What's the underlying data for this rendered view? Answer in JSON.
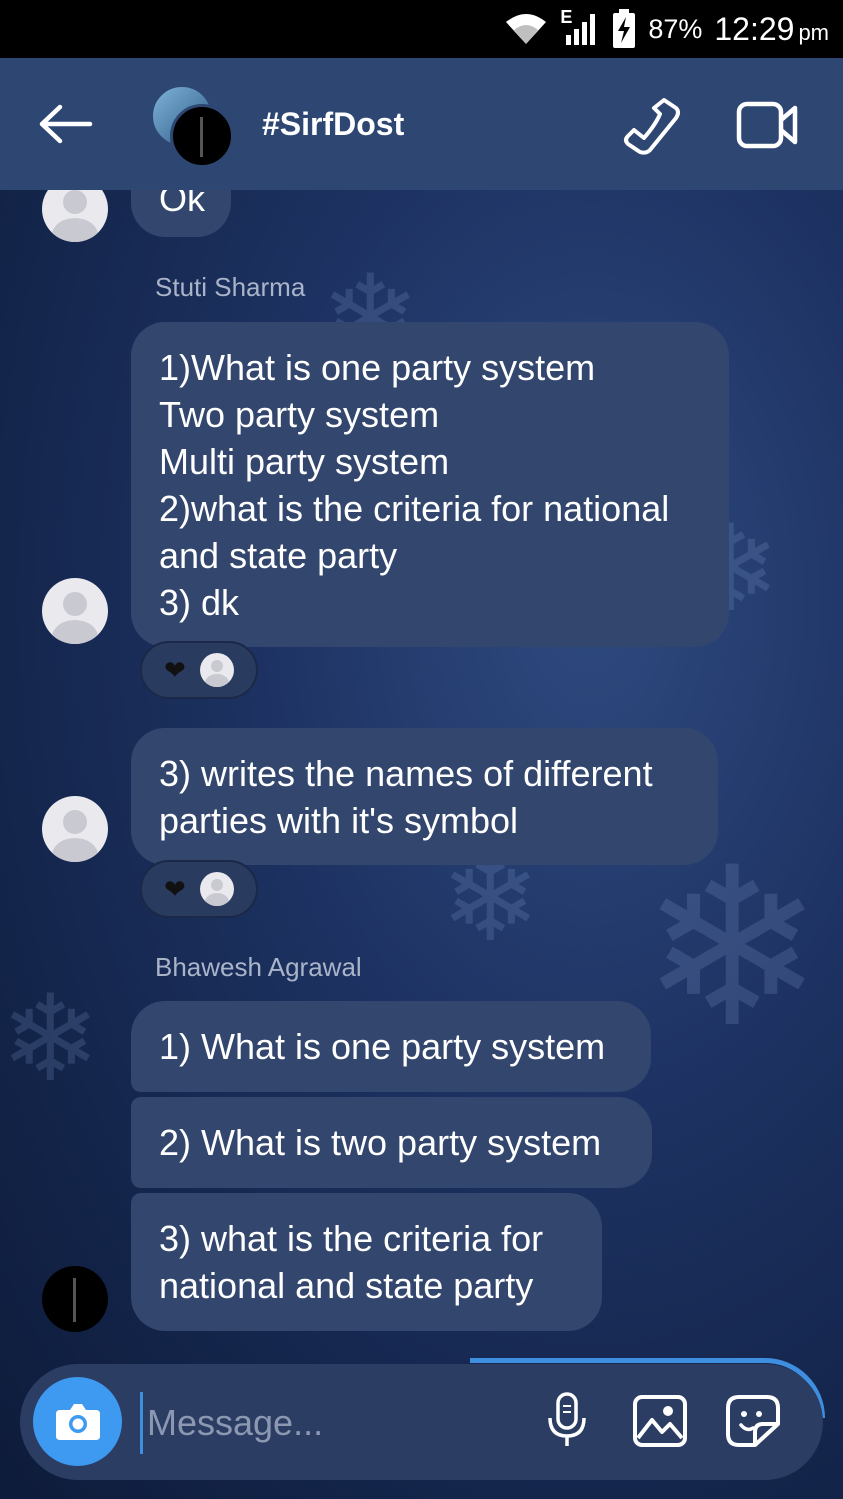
{
  "status_bar": {
    "network_label": "E",
    "battery_percent": "87%",
    "time": "12:29",
    "ampm": "pm"
  },
  "header": {
    "title": "#SirfDost"
  },
  "messages": {
    "partial": "Ok",
    "sender1": "Stuti Sharma",
    "m1_lines": [
      "1)What is one party system",
      "Two party system",
      "Multi party system",
      "2)what is the criteria for national",
      "and state party",
      "3) dk"
    ],
    "m2_lines": [
      "3) writes the names of different",
      "parties with it's symbol"
    ],
    "reaction_heart": "❤",
    "sender2": "Bhawesh Agrawal",
    "m3": "1) What is one party system",
    "m4": "2) What is two party system",
    "m5_lines": [
      "3) what is the criteria for",
      "national and state party"
    ]
  },
  "composer": {
    "placeholder": "Message..."
  },
  "icons": {
    "back": "arrow-left-icon",
    "call": "phone-icon",
    "video": "video-camera-icon",
    "camera": "camera-icon",
    "mic": "microphone-icon",
    "gallery": "image-icon",
    "sticker": "sticker-icon"
  },
  "colors": {
    "accent": "#3e99f0",
    "bubble": "#33466e",
    "header": "#2e4672"
  }
}
